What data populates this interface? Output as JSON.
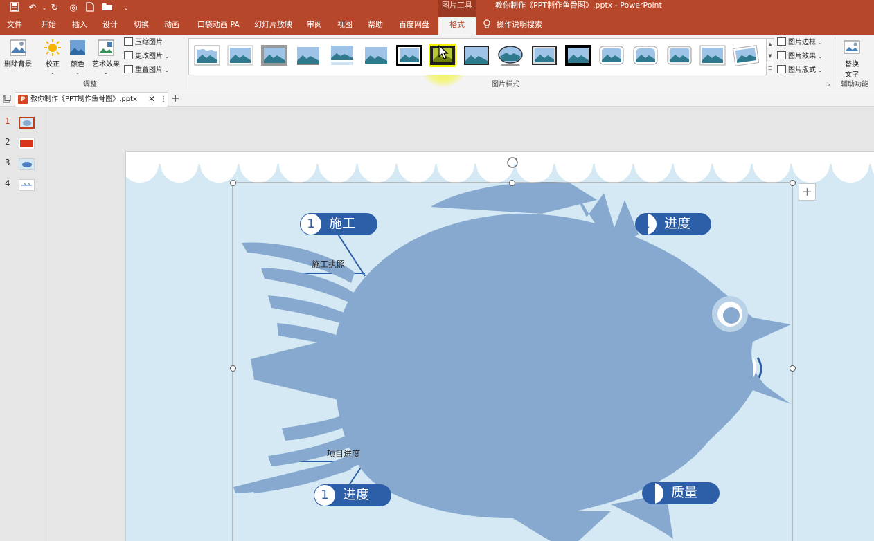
{
  "title_bar": {
    "contextual_group": "图片工具",
    "window_title": "教你制作《PPT制作鱼骨图》.pptx  -  PowerPoint"
  },
  "tabs": [
    {
      "label": "文件"
    },
    {
      "label": "开始"
    },
    {
      "label": "插入"
    },
    {
      "label": "设计"
    },
    {
      "label": "切换"
    },
    {
      "label": "动画"
    },
    {
      "label": "口袋动画 PA"
    },
    {
      "label": "幻灯片放映"
    },
    {
      "label": "审阅"
    },
    {
      "label": "视图"
    },
    {
      "label": "帮助"
    },
    {
      "label": "百度网盘"
    },
    {
      "label": "格式"
    }
  ],
  "tell_me": "操作说明搜索",
  "ribbon": {
    "remove_bg": "删除背景",
    "corrections": "校正",
    "color": "颜色",
    "artistic": "艺术效果",
    "compress": "压缩图片",
    "change": "更改图片",
    "reset": "重置图片",
    "group_adjust": "调整",
    "group_styles": "图片样式",
    "border": "图片边框",
    "effects": "图片效果",
    "layout": "图片版式",
    "alt_text_line1": "替换",
    "alt_text_line2": "文字",
    "group_accessibility": "辅助功能"
  },
  "doc_tab": {
    "name": "教你制作《PPT制作鱼骨图》.pptx"
  },
  "thumbnails": [
    "1",
    "2",
    "3",
    "4"
  ],
  "slide": {
    "top_left_num": "1",
    "top_left_label": "施工",
    "top_right_num": "1",
    "top_right_label": "进度",
    "bottom_left_num": "1",
    "bottom_left_label": "进度",
    "bottom_right_label": "质量",
    "sub_label_1": "施工执照",
    "sub_label_2": "项目进度"
  },
  "colors": {
    "accent": "#b7472a",
    "pill": "#2d5ea8",
    "fish": "#87a8cf",
    "slide_bg": "#d4e9f3"
  }
}
